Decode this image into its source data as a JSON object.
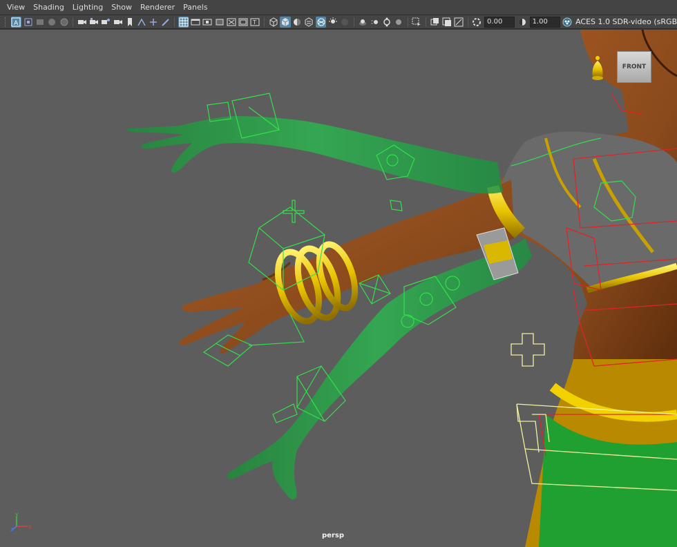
{
  "menu": {
    "items": [
      "View",
      "Shading",
      "Lighting",
      "Show",
      "Renderer",
      "Panels"
    ]
  },
  "toolbar": {
    "exposure_value": "0.00",
    "gamma_value": "1.00",
    "color_space": "ACES 1.0 SDR-video (sRGB",
    "accent": "#5285a6"
  },
  "viewport": {
    "camera_name": "persp",
    "view_cube_label": "FRONT",
    "axis_labels": {
      "y": "y",
      "z": "z",
      "x": "x"
    },
    "background": "#5d5d5d"
  },
  "colors": {
    "skin": "#8a4a1c",
    "green_ghost": "#2fae4e",
    "gold": "#e7c200",
    "control_green": "#33e04c",
    "control_red": "#e02424",
    "control_yellow": "#f4f0a0"
  }
}
